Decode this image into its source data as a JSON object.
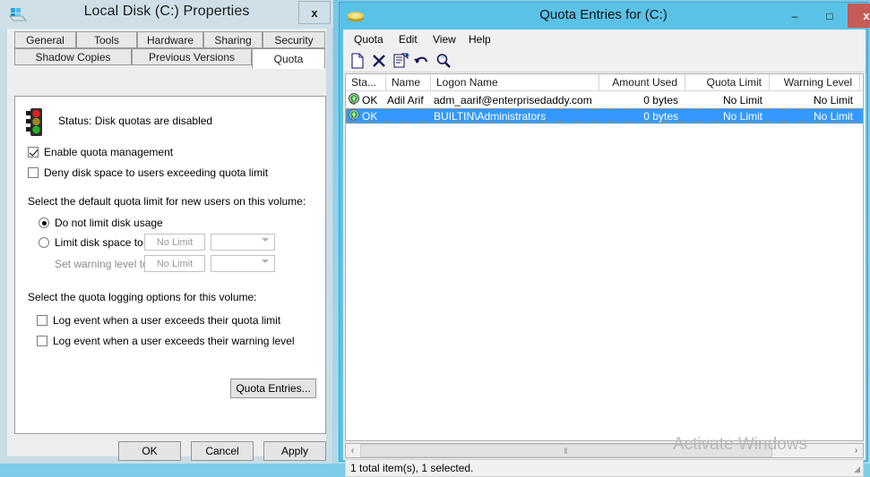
{
  "properties_window": {
    "title": "Local Disk (C:) Properties",
    "icon": "disk-drive-icon",
    "close_label": "x",
    "tabs_row1": [
      {
        "label": "General",
        "active": false
      },
      {
        "label": "Tools",
        "active": false
      },
      {
        "label": "Hardware",
        "active": false
      },
      {
        "label": "Sharing",
        "active": false
      },
      {
        "label": "Security",
        "active": false
      }
    ],
    "tabs_row2": [
      {
        "label": "Shadow Copies",
        "active": false
      },
      {
        "label": "Previous Versions",
        "active": false
      },
      {
        "label": "Quota",
        "active": true
      }
    ],
    "quota_tab": {
      "status_icon": "traffic-light-icon",
      "status_text": "Status:  Disk quotas are disabled",
      "enable_quota_label": "Enable quota management",
      "enable_quota_checked": true,
      "deny_label": "Deny disk space to users exceeding quota limit",
      "deny_checked": false,
      "default_limit_heading": "Select the default quota limit for new users on this volume:",
      "radio_nolimit_label": "Do not limit disk usage",
      "radio_nolimit_selected": true,
      "radio_limit_label": "Limit disk space to",
      "radio_limit_selected": false,
      "limit_value": "No Limit",
      "limit_unit": "",
      "warning_label": "Set warning level to",
      "warning_value": "No Limit",
      "warning_unit": "",
      "logging_heading": "Select the quota logging options for this volume:",
      "log_quota_label": "Log event when a user exceeds their quota limit",
      "log_quota_checked": false,
      "log_warning_label": "Log event when a user exceeds their warning level",
      "log_warning_checked": false,
      "quota_entries_button": "Quota Entries..."
    },
    "buttons": {
      "ok": "OK",
      "cancel": "Cancel",
      "apply": "Apply"
    }
  },
  "quota_entries_window": {
    "title": "Quota Entries for  (C:)",
    "icon": "quota-disk-icon",
    "window_buttons": {
      "minimize": "–",
      "maximize": "□",
      "close": "x"
    },
    "menu": [
      "Quota",
      "Edit",
      "View",
      "Help"
    ],
    "toolbar_icons": [
      "new-quota-entry-icon",
      "delete-icon",
      "properties-icon",
      "undo-icon",
      "find-icon"
    ],
    "columns": [
      "Sta...",
      "Name",
      "Logon Name",
      "Amount Used",
      "Quota Limit",
      "Warning Level"
    ],
    "rows": [
      {
        "status_icon": "status-ok-icon",
        "status": "OK",
        "name": "Adil Arif",
        "logon_name": "adm_aarif@enterprisedaddy.com",
        "amount_used": "0 bytes",
        "quota_limit": "No Limit",
        "warning_level": "No Limit",
        "selected": false
      },
      {
        "status_icon": "status-ok-icon",
        "status": "OK",
        "name": "",
        "logon_name": "BUILTIN\\Administrators",
        "amount_used": "0 bytes",
        "quota_limit": "No Limit",
        "warning_level": "No Limit",
        "selected": true
      }
    ],
    "status_bar": "1 total item(s), 1 selected.",
    "scrollbar": {
      "left_arrow": "‹",
      "right_arrow": "›",
      "grip": "‖"
    }
  },
  "desktop": {
    "watermark": "Activate Windows"
  },
  "colors": {
    "title_bar_accent": "#5bc2e7",
    "close_button": "#c75b56",
    "selection_blue": "#3399ff",
    "dialog_face": "#eceded",
    "desktop": "#8fd0ea"
  }
}
